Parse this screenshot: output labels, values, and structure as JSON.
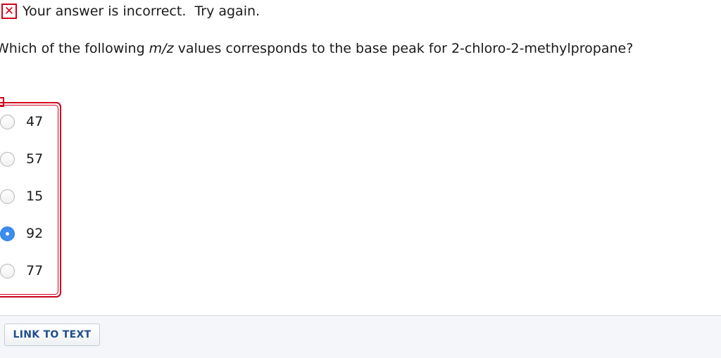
{
  "feedback": {
    "icon": "x-mark-icon",
    "color": "#d0021b",
    "text": "Your answer is incorrect.  Try again."
  },
  "question": {
    "prefix": "Which of the following ",
    "emphasis": "m/z",
    "suffix": " values corresponds to the base peak for 2-chloro-2-methylpropane?"
  },
  "options": [
    {
      "label": "47",
      "selected": false
    },
    {
      "label": "57",
      "selected": false
    },
    {
      "label": "15",
      "selected": false
    },
    {
      "label": "92",
      "selected": true
    },
    {
      "label": "77",
      "selected": false
    }
  ],
  "footer": {
    "link_label": "LINK TO TEXT"
  },
  "colors": {
    "error": "#d0021b",
    "radio_selected": "#3b8ef0",
    "link_text": "#1f4e8c"
  }
}
